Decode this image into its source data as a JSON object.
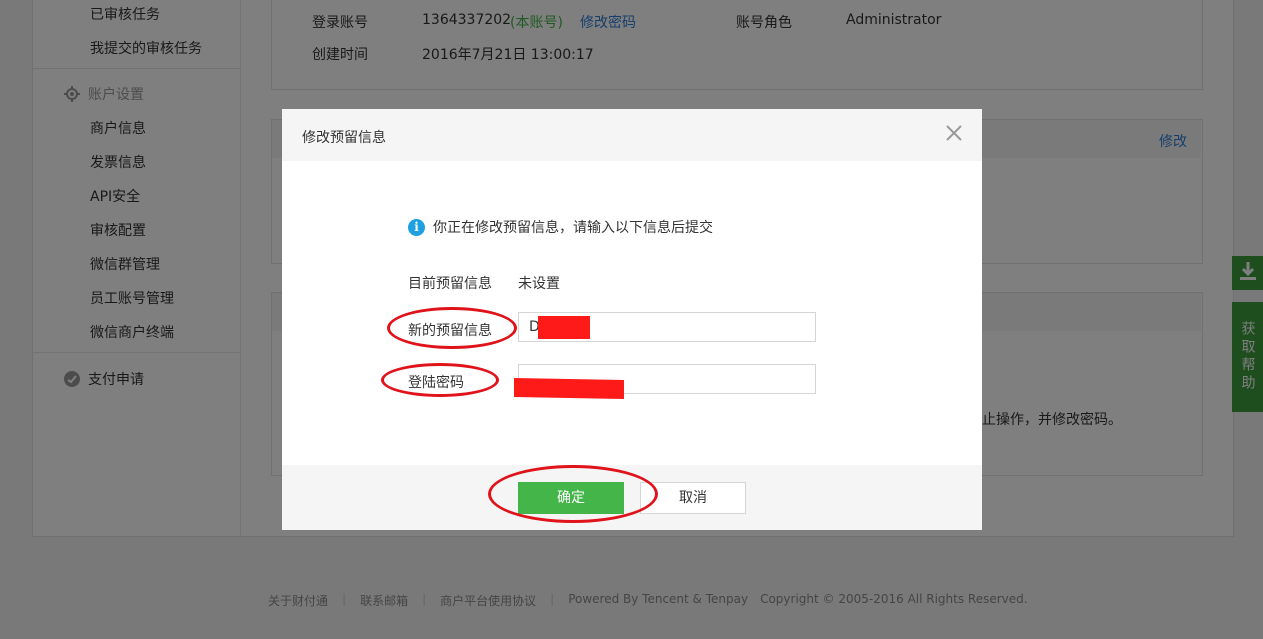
{
  "sidebar": {
    "items_top": [
      "已审核任务",
      "我提交的审核任务"
    ],
    "account_group": "账户设置",
    "account_items": [
      "商户信息",
      "发票信息",
      "API安全",
      "审核配置",
      "微信群管理",
      "员工账号管理",
      "微信商户终端"
    ],
    "pay_group": "支付申请"
  },
  "account_info": {
    "login_label": "登录账号",
    "login_value": "1364337202",
    "login_tag": "(本账号)",
    "change_password": "修改密码",
    "role_label": "账号角色",
    "role_value": "Administrator",
    "created_label": "创建时间",
    "created_value": "2016年7月21日 13:00:17"
  },
  "section_edit_link": "修改",
  "background_text": "止操作，并修改密码。",
  "modal": {
    "title": "修改预留信息",
    "notice": "你正在修改预留信息，请输入以下信息后提交",
    "current_label": "目前预留信息",
    "current_value": "未设置",
    "new_label": "新的预留信息",
    "new_value": "D",
    "password_label": "登陆密码",
    "ok_label": "确定",
    "cancel_label": "取消"
  },
  "footer": {
    "links": [
      "关于财付通",
      "联系邮箱",
      "商户平台使用协议"
    ],
    "powered": "Powered By Tencent & Tenpay",
    "copyright": "Copyright © 2005-2016 All Rights Reserved."
  },
  "float": {
    "help": "获取帮助"
  },
  "colors": {
    "accent_green": "#44b549",
    "link_blue": "#2e7cd4",
    "tag_green": "#44b549",
    "annotation_red": "#e0121a"
  }
}
